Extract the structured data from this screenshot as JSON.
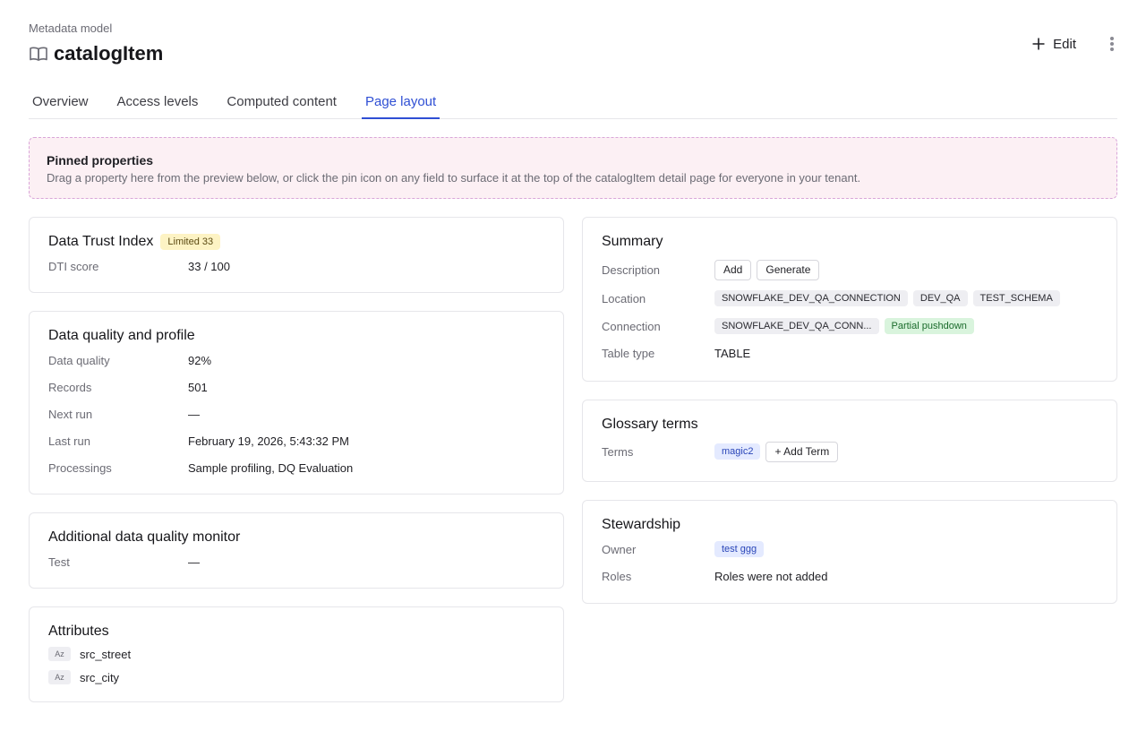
{
  "header": {
    "eyebrow": "Metadata model",
    "title": "catalogItem",
    "edit_label": "Edit",
    "icons": {
      "title": "book-open-icon",
      "edit": "plus-icon",
      "more": "more-vertical-icon"
    }
  },
  "tabs": [
    {
      "label": "Overview",
      "active": false
    },
    {
      "label": "Access levels",
      "active": false
    },
    {
      "label": "Computed content",
      "active": false
    },
    {
      "label": "Page layout",
      "active": true
    }
  ],
  "pinned": {
    "title": "Pinned properties",
    "description": "Drag a property here from the preview below, or click the pin icon on any field to surface it at the top of the catalogItem detail page for everyone in your tenant."
  },
  "dti": {
    "title": "Data Trust Index",
    "badge": "Limited 33",
    "rows": [
      {
        "label": "DTI score",
        "value": "33 / 100"
      }
    ]
  },
  "dq": {
    "title": "Data quality and profile",
    "rows": [
      {
        "label": "Data quality",
        "value": "92%"
      },
      {
        "label": "Records",
        "value": "501"
      },
      {
        "label": "Next run",
        "value": "—"
      },
      {
        "label": "Last run",
        "value": "February 19, 2026, 5:43:32 PM"
      },
      {
        "label": "Processings",
        "value": "Sample profiling, DQ Evaluation"
      }
    ]
  },
  "monitor": {
    "title": "Additional data quality monitor",
    "rows": [
      {
        "label": "Test",
        "value": "—"
      }
    ]
  },
  "attributes": {
    "title": "Attributes",
    "type_badge": "Az",
    "items": [
      "src_street",
      "src_city"
    ]
  },
  "summary": {
    "title": "Summary",
    "description_label": "Description",
    "add_label": "Add",
    "generate_label": "Generate",
    "location_label": "Location",
    "location_chips": [
      "SNOWFLAKE_DEV_QA_CONNECTION",
      "DEV_QA",
      "TEST_SCHEMA"
    ],
    "connection_label": "Connection",
    "connection_chip": "SNOWFLAKE_DEV_QA_CONN...",
    "pushdown_chip": "Partial pushdown",
    "table_type_label": "Table type",
    "table_type_value": "TABLE"
  },
  "glossary": {
    "title": "Glossary terms",
    "terms_label": "Terms",
    "term": "magic2",
    "add_term_label": "+ Add Term"
  },
  "stewardship": {
    "title": "Stewardship",
    "owner_label": "Owner",
    "owner": "test ggg",
    "roles_label": "Roles",
    "roles_value": "Roles were not added"
  },
  "colors": {
    "accent": "#2f4fd4",
    "pinned_bg": "#fcf0f4",
    "pinned_border": "#d9a6d9",
    "badge_yellow": "#fdf3c4",
    "chip_green": "#d9f4dd",
    "chip_blue": "#e4eaff"
  }
}
